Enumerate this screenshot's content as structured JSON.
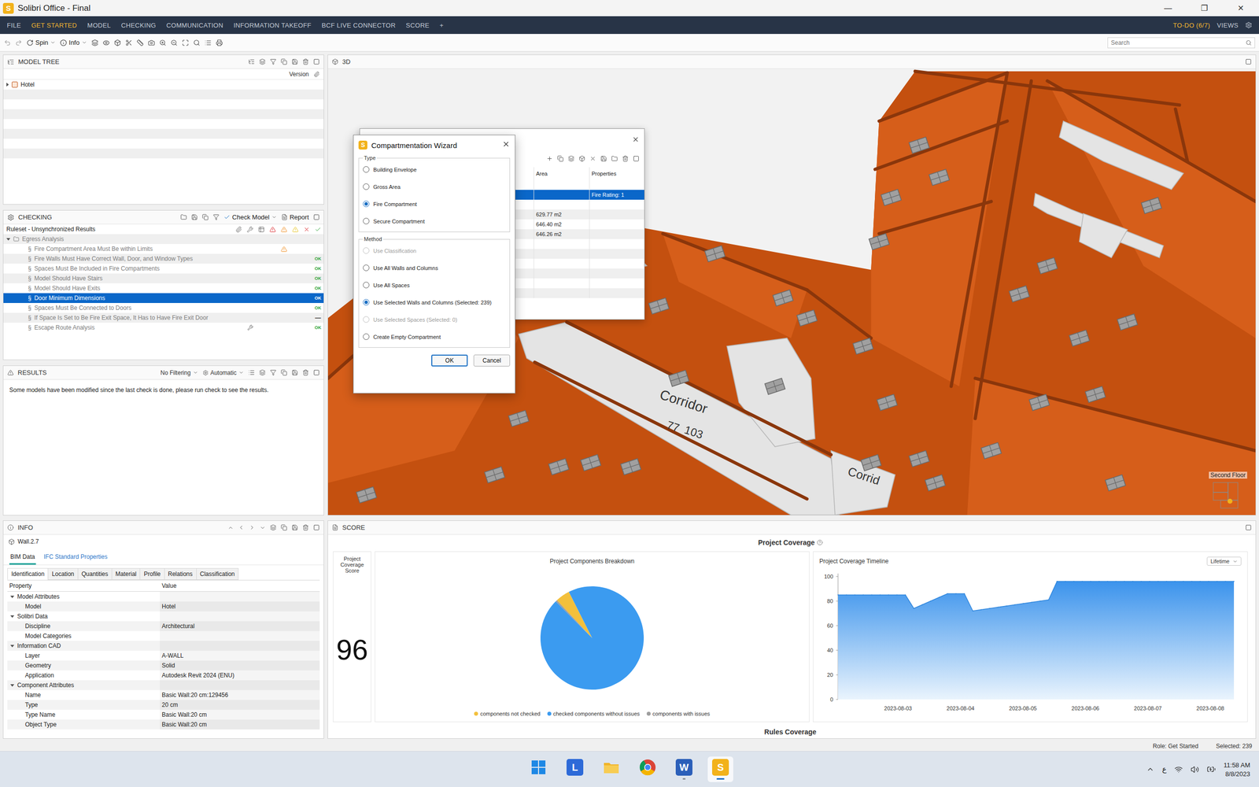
{
  "window": {
    "logo": "S",
    "title": "Solibri Office - Final",
    "controls": [
      "—",
      "❐",
      "✕"
    ]
  },
  "menu": {
    "items": [
      {
        "label": "FILE",
        "selected": false
      },
      {
        "label": "GET STARTED",
        "selected": true
      },
      {
        "label": "MODEL",
        "selected": false
      },
      {
        "label": "CHECKING",
        "selected": false
      },
      {
        "label": "COMMUNICATION",
        "selected": false
      },
      {
        "label": "INFORMATION TAKEOFF",
        "selected": false
      },
      {
        "label": "BCF LIVE CONNECTOR",
        "selected": false
      },
      {
        "label": "SCORE",
        "selected": false
      },
      {
        "label": "+",
        "selected": false
      }
    ],
    "todo": "TO-DO (6/7)",
    "views": "VIEWS"
  },
  "toolbar": {
    "spin": "Spin",
    "info": "Info",
    "search_placeholder": "Search"
  },
  "model_tree": {
    "title": "MODEL TREE",
    "column": "Version",
    "items": [
      {
        "label": "Hotel",
        "expanded": false
      }
    ]
  },
  "checking": {
    "title": "CHECKING",
    "check_model": "Check Model",
    "report": "Report",
    "ruleset": "Ruleset - Unsynchronized Results",
    "group": {
      "label": "Egress Analysis",
      "expanded": true,
      "dimmed": true
    },
    "rules": [
      {
        "marker": "§",
        "label": "Fire Compartment Area Must Be within Limits",
        "kind": "warning",
        "result": "",
        "selected": false,
        "dimmed": true,
        "tool": false
      },
      {
        "marker": "§",
        "label": "Fire Walls Must Have Correct Wall, Door, and Window Types",
        "kind": "ok",
        "result": "OK",
        "selected": false,
        "dimmed": true,
        "tool": false
      },
      {
        "marker": "§",
        "label": "Spaces Must Be Included in Fire Compartments",
        "kind": "ok",
        "result": "OK",
        "selected": false,
        "dimmed": true,
        "tool": false
      },
      {
        "marker": "§",
        "label": "Model Should Have Stairs",
        "kind": "ok",
        "result": "OK",
        "selected": false,
        "dimmed": true,
        "tool": false
      },
      {
        "marker": "§",
        "label": "Model Should Have Exits",
        "kind": "ok",
        "result": "OK",
        "selected": false,
        "dimmed": true,
        "tool": false
      },
      {
        "marker": "§",
        "label": "Door Minimum Dimensions",
        "kind": "ok",
        "result": "OK",
        "selected": true,
        "dimmed": false,
        "tool": false
      },
      {
        "marker": "§",
        "label": "Spaces Must Be Connected to Doors",
        "kind": "ok",
        "result": "OK",
        "selected": false,
        "dimmed": true,
        "tool": false
      },
      {
        "marker": "§",
        "label": "If Space Is Set to Be Fire Exit Space, It Has to Have Fire Exit Door",
        "kind": "none",
        "result": "—",
        "selected": false,
        "dimmed": true,
        "tool": false
      },
      {
        "marker": "§",
        "label": "Escape Route Analysis",
        "kind": "ok",
        "result": "OK",
        "selected": false,
        "dimmed": true,
        "tool": true
      }
    ]
  },
  "results": {
    "title": "RESULTS",
    "filter": "No Filtering",
    "mode": "Automatic",
    "message": "Some models have been modified since the last check is done, please run check to see the results."
  },
  "viewport": {
    "title": "3D",
    "labels": [
      "Corridor",
      "77",
      "103",
      "Corrid"
    ],
    "floor": "Second Floor"
  },
  "compartments": {
    "columns": [
      "Area",
      "Properties"
    ],
    "rows": [
      {
        "area": "",
        "properties": "",
        "selected": false
      },
      {
        "area": "",
        "properties": "Fire Rating: 1",
        "selected": true
      },
      {
        "area": "",
        "properties": "",
        "selected": false
      },
      {
        "area": "629.77 m2",
        "properties": "",
        "selected": false
      },
      {
        "area": "646.40 m2",
        "properties": "",
        "selected": false
      },
      {
        "area": "646.26 m2",
        "properties": "",
        "selected": false
      },
      {
        "area": "",
        "properties": "",
        "selected": false
      },
      {
        "area": "",
        "properties": "",
        "selected": false
      },
      {
        "area": "",
        "properties": "",
        "selected": false
      },
      {
        "area": "",
        "properties": "",
        "selected": false
      },
      {
        "area": "",
        "properties": "",
        "selected": false
      },
      {
        "area": "",
        "properties": "",
        "selected": false
      }
    ]
  },
  "wizard": {
    "logo": "S",
    "title": "Compartmentation Wizard",
    "type": {
      "legend": "Type",
      "options": [
        {
          "label": "Building Envelope",
          "selected": false,
          "disabled": false
        },
        {
          "label": "Gross Area",
          "selected": false,
          "disabled": false
        },
        {
          "label": "Fire Compartment",
          "selected": true,
          "disabled": false
        },
        {
          "label": "Secure Compartment",
          "selected": false,
          "disabled": false
        }
      ]
    },
    "method": {
      "legend": "Method",
      "options": [
        {
          "label": "Use Classification",
          "selected": false,
          "disabled": true
        },
        {
          "label": "Use All Walls and Columns",
          "selected": false,
          "disabled": false
        },
        {
          "label": "Use All Spaces",
          "selected": false,
          "disabled": false
        },
        {
          "label": "Use Selected Walls and Columns (Selected: 239)",
          "selected": true,
          "disabled": false
        },
        {
          "label": "Use Selected Spaces (Selected: 0)",
          "selected": false,
          "disabled": true
        },
        {
          "label": "Create Empty Compartment",
          "selected": false,
          "disabled": false
        }
      ]
    },
    "buttons": [
      {
        "label": "OK",
        "default": true
      },
      {
        "label": "Cancel",
        "default": false
      }
    ]
  },
  "info": {
    "title": "INFO",
    "object": "Wall.2.7",
    "tabs": [
      {
        "label": "BIM Data",
        "selected": true
      },
      {
        "label": "IFC Standard Properties",
        "selected": false
      }
    ],
    "subtabs": [
      {
        "label": "Identification",
        "selected": true
      },
      {
        "label": "Location",
        "selected": false
      },
      {
        "label": "Quantities",
        "selected": false
      },
      {
        "label": "Material",
        "selected": false
      },
      {
        "label": "Profile",
        "selected": false
      },
      {
        "label": "Relations",
        "selected": false
      },
      {
        "label": "Classification",
        "selected": false
      }
    ],
    "columns": [
      "Property",
      "Value"
    ],
    "rows": [
      {
        "kind": "group",
        "label": "Model Attributes",
        "expanded": true
      },
      {
        "kind": "prop",
        "property": "Model",
        "value": "Hotel"
      },
      {
        "kind": "group",
        "label": "Solibri Data",
        "expanded": true
      },
      {
        "kind": "prop",
        "property": "Discipline",
        "value": "Architectural"
      },
      {
        "kind": "prop",
        "property": "Model Categories",
        "value": ""
      },
      {
        "kind": "group",
        "label": "Information CAD",
        "expanded": true
      },
      {
        "kind": "prop",
        "property": "Layer",
        "value": "A-WALL"
      },
      {
        "kind": "prop",
        "property": "Geometry",
        "value": "Solid"
      },
      {
        "kind": "prop",
        "property": "Application",
        "value": "Autodesk Revit 2024 (ENU)"
      },
      {
        "kind": "group",
        "label": "Component Attributes",
        "expanded": true
      },
      {
        "kind": "prop",
        "property": "Name",
        "value": "Basic Wall:20 cm:129456"
      },
      {
        "kind": "prop",
        "property": "Type",
        "value": "20 cm"
      },
      {
        "kind": "prop",
        "property": "Type Name",
        "value": "Basic Wall:20 cm"
      },
      {
        "kind": "prop",
        "property": "Object Type",
        "value": "Basic Wall:20 cm"
      }
    ]
  },
  "score": {
    "title": "SCORE",
    "heading": "Project Coverage",
    "card": {
      "title": "Project Coverage Score",
      "value": "96"
    },
    "breakdown": {
      "title": "Project Components Breakdown",
      "slices": [
        {
          "label": "components not checked",
          "value": 0.045,
          "color": "#f3c03c"
        },
        {
          "label": "checked components without issues",
          "value": 0.95,
          "color": "#3b9bf0"
        },
        {
          "label": "components with issues",
          "value": 0.005,
          "color": "#9e9e9e"
        }
      ]
    },
    "timeline": {
      "title": "Project Coverage Timeline",
      "range": "Lifetime",
      "y_ticks": [
        "100",
        "80",
        "60",
        "40",
        "20",
        "0"
      ],
      "x_ticks": [
        "2023-08-03",
        "2023-08-04",
        "2023-08-05",
        "2023-08-06",
        "2023-08-07",
        "2023-08-08"
      ],
      "series": [
        {
          "name": "coverage",
          "values": [
            85,
            85,
            85,
            85,
            85,
            85,
            85,
            85,
            85,
            74,
            77,
            80,
            83,
            86,
            86,
            86,
            72,
            73,
            74,
            75,
            76,
            77,
            78,
            79,
            80,
            81,
            96,
            96,
            96,
            96,
            96,
            96,
            96,
            96,
            96,
            96,
            96,
            96,
            96,
            96,
            96,
            96,
            96,
            96,
            96,
            96,
            96,
            96
          ]
        }
      ]
    },
    "footer": "Rules Coverage"
  },
  "status_bar": {
    "role": "Role: Get Started",
    "selected": "Selected: 239"
  },
  "taskbar": {
    "apps": [
      {
        "kind": "start",
        "label": "",
        "running": false,
        "active": false
      },
      {
        "kind": "letter",
        "label": "L",
        "running": false,
        "active": false
      },
      {
        "kind": "folder",
        "label": "",
        "running": false,
        "active": false
      },
      {
        "kind": "chrome",
        "label": "",
        "running": false,
        "active": false
      },
      {
        "kind": "word",
        "label": "W",
        "running": true,
        "active": false
      },
      {
        "kind": "solibri",
        "label": "S",
        "running": true,
        "active": true
      }
    ],
    "lang": "ع",
    "time": "11:58 AM",
    "date": "8/8/2023"
  }
}
